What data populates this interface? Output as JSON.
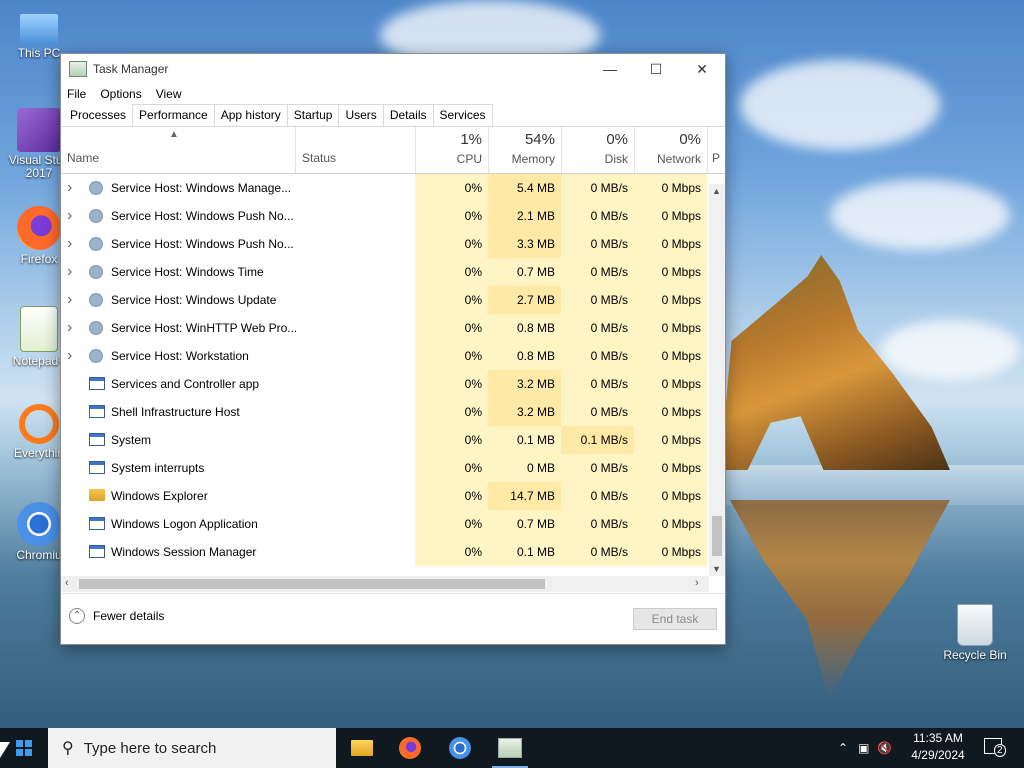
{
  "desktop": {
    "icons": [
      {
        "label": "This PC",
        "icon": "computer-icon"
      },
      {
        "label": "Visual Stud 2017",
        "icon": "visual-studio-icon"
      },
      {
        "label": "Firefox",
        "icon": "firefox-icon"
      },
      {
        "label": "Notepad+",
        "icon": "notepad-plus-icon"
      },
      {
        "label": "Everythin",
        "icon": "everything-search-icon"
      },
      {
        "label": "Chromiu",
        "icon": "chromium-icon"
      }
    ],
    "recycle_bin": "Recycle Bin"
  },
  "window": {
    "title": "Task Manager",
    "menu": [
      "File",
      "Options",
      "View"
    ],
    "tabs": [
      "Processes",
      "Performance",
      "App history",
      "Startup",
      "Users",
      "Details",
      "Services"
    ],
    "active_tab": "Processes",
    "columns": {
      "name": "Name",
      "status": "Status",
      "cpu": {
        "pct": "1%",
        "label": "CPU"
      },
      "memory": {
        "pct": "54%",
        "label": "Memory"
      },
      "disk": {
        "pct": "0%",
        "label": "Disk"
      },
      "network": {
        "pct": "0%",
        "label": "Network"
      },
      "power": "P"
    },
    "rows": [
      {
        "expand": true,
        "icon": "gear",
        "name": "Service Host: Windows Manage...",
        "cpu": "0%",
        "mem": "5.4 MB",
        "disk": "0 MB/s",
        "net": "0 Mbps"
      },
      {
        "expand": true,
        "icon": "gear",
        "name": "Service Host: Windows Push No...",
        "cpu": "0%",
        "mem": "2.1 MB",
        "disk": "0 MB/s",
        "net": "0 Mbps"
      },
      {
        "expand": true,
        "icon": "gear",
        "name": "Service Host: Windows Push No...",
        "cpu": "0%",
        "mem": "3.3 MB",
        "disk": "0 MB/s",
        "net": "0 Mbps"
      },
      {
        "expand": true,
        "icon": "gear",
        "name": "Service Host: Windows Time",
        "cpu": "0%",
        "mem": "0.7 MB",
        "disk": "0 MB/s",
        "net": "0 Mbps"
      },
      {
        "expand": true,
        "icon": "gear",
        "name": "Service Host: Windows Update",
        "cpu": "0%",
        "mem": "2.7 MB",
        "disk": "0 MB/s",
        "net": "0 Mbps"
      },
      {
        "expand": true,
        "icon": "gear",
        "name": "Service Host: WinHTTP Web Pro...",
        "cpu": "0%",
        "mem": "0.8 MB",
        "disk": "0 MB/s",
        "net": "0 Mbps"
      },
      {
        "expand": true,
        "icon": "gear",
        "name": "Service Host: Workstation",
        "cpu": "0%",
        "mem": "0.8 MB",
        "disk": "0 MB/s",
        "net": "0 Mbps"
      },
      {
        "expand": false,
        "icon": "app",
        "name": "Services and Controller app",
        "cpu": "0%",
        "mem": "3.2 MB",
        "disk": "0 MB/s",
        "net": "0 Mbps"
      },
      {
        "expand": false,
        "icon": "app",
        "name": "Shell Infrastructure Host",
        "cpu": "0%",
        "mem": "3.2 MB",
        "disk": "0 MB/s",
        "net": "0 Mbps"
      },
      {
        "expand": false,
        "icon": "app",
        "name": "System",
        "cpu": "0%",
        "mem": "0.1 MB",
        "disk": "0.1 MB/s",
        "net": "0 Mbps"
      },
      {
        "expand": false,
        "icon": "app",
        "name": "System interrupts",
        "cpu": "0%",
        "mem": "0 MB",
        "disk": "0 MB/s",
        "net": "0 Mbps"
      },
      {
        "expand": false,
        "icon": "folder",
        "name": "Windows Explorer",
        "cpu": "0%",
        "mem": "14.7 MB",
        "disk": "0 MB/s",
        "net": "0 Mbps"
      },
      {
        "expand": false,
        "icon": "app",
        "name": "Windows Logon Application",
        "cpu": "0%",
        "mem": "0.7 MB",
        "disk": "0 MB/s",
        "net": "0 Mbps"
      },
      {
        "expand": false,
        "icon": "app",
        "name": "Windows Session Manager",
        "cpu": "0%",
        "mem": "0.1 MB",
        "disk": "0 MB/s",
        "net": "0 Mbps"
      }
    ],
    "fewer_details": "Fewer details",
    "end_task": "End task"
  },
  "taskbar": {
    "search_placeholder": "Type here to search",
    "apps": [
      "file-explorer-icon",
      "firefox-icon",
      "chromium-icon",
      "task-manager-icon"
    ],
    "time": "11:35 AM",
    "date": "4/29/2024",
    "notification_count": "2"
  }
}
